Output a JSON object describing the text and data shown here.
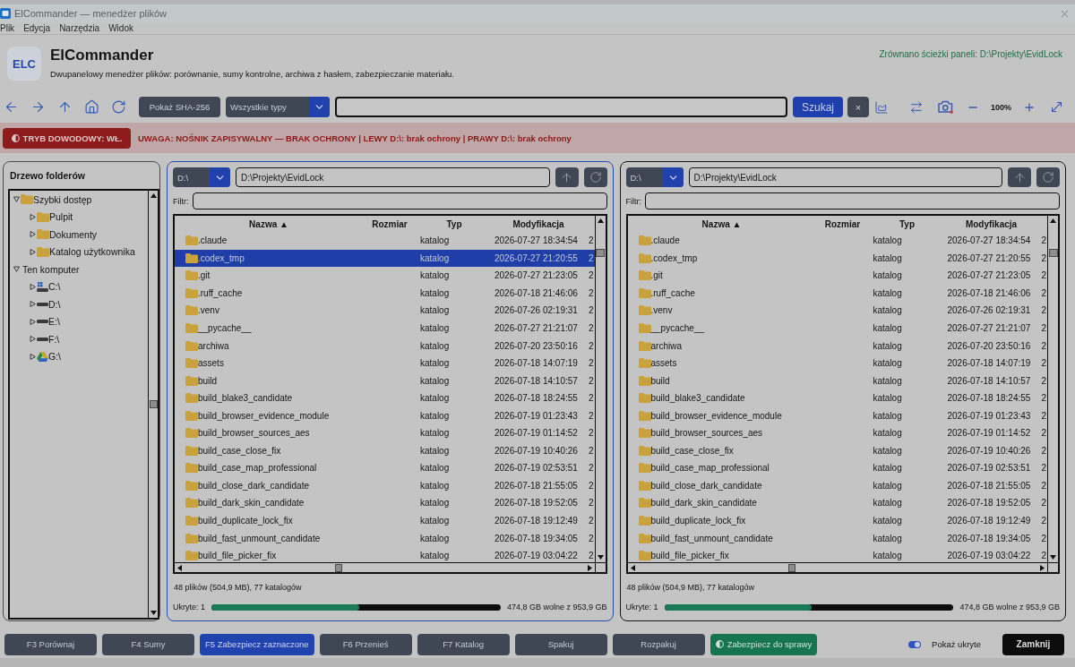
{
  "window": {
    "title": "ElCommander — menedżer plików"
  },
  "menu": [
    "Plik",
    "Edycja",
    "Narzędzia",
    "Widok"
  ],
  "header": {
    "logo": "ELC",
    "title": "ElCommander",
    "subtitle": "Dwupanelowy menedżer plików: porównanie, sumy kontrolne, archiwa z hasłem, zabezpieczanie materiału.",
    "sync_status": "Zrównano ścieżki paneli: D:\\Projekty\\EvidLock"
  },
  "toolbar": {
    "hash_button": "Pokaż SHA-256",
    "type_filter": "Wszystkie typy",
    "search_button": "Szukaj",
    "clear_button": "×",
    "zoom": "100%"
  },
  "evidence_bar": {
    "mode_button": "TRYB DOWODOWY: WŁ.",
    "warning": "UWAGA: NOŚNIK ZAPISYWALNY — BRAK OCHRONY | LEWY D:\\: brak ochrony | PRAWY D:\\: brak ochrony"
  },
  "tree": {
    "title": "Drzewo folderów",
    "items": [
      {
        "label": "Szybki dostęp",
        "kind": "folder",
        "expanded": true,
        "children": [
          {
            "label": "Pulpit",
            "kind": "folder",
            "expanded": false
          },
          {
            "label": "Dokumenty",
            "kind": "folder",
            "expanded": false
          },
          {
            "label": "Katalog użytkownika",
            "kind": "folder",
            "expanded": false
          }
        ]
      },
      {
        "label": "Ten komputer",
        "kind": "group",
        "expanded": true,
        "children": [
          {
            "label": "C:\\",
            "kind": "system-drive",
            "expanded": false
          },
          {
            "label": "D:\\",
            "kind": "drive",
            "expanded": false
          },
          {
            "label": "E:\\",
            "kind": "drive",
            "expanded": false
          },
          {
            "label": "F:\\",
            "kind": "drive",
            "expanded": false
          },
          {
            "label": "G:\\",
            "kind": "cloud-drive",
            "expanded": false
          }
        ]
      }
    ]
  },
  "panels": [
    {
      "active": true,
      "drive": "D:\\",
      "path": "D:\\Projekty\\EvidLock",
      "filter_label": "Filtr:",
      "columns": [
        "Nazwa ▲",
        "Rozmiar",
        "Typ",
        "Modyfikacja"
      ],
      "rows": [
        {
          "name": ".claude",
          "type": "katalog",
          "modified": "2026-07-27 18:34:54",
          "column_5": "2",
          "selected": false
        },
        {
          "name": ".codex_tmp",
          "type": "katalog",
          "modified": "2026-07-27 21:20:55",
          "column_5": "2",
          "selected": true
        },
        {
          "name": ".git",
          "type": "katalog",
          "modified": "2026-07-27 21:23:05",
          "column_5": "2",
          "selected": false
        },
        {
          "name": ".ruff_cache",
          "type": "katalog",
          "modified": "2026-07-18 21:46:06",
          "column_5": "2",
          "selected": false
        },
        {
          "name": ".venv",
          "type": "katalog",
          "modified": "2026-07-26 02:19:31",
          "column_5": "2",
          "selected": false
        },
        {
          "name": "__pycache__",
          "type": "katalog",
          "modified": "2026-07-27 21:21:07",
          "column_5": "2",
          "selected": false
        },
        {
          "name": "archiwa",
          "type": "katalog",
          "modified": "2026-07-20 23:50:16",
          "column_5": "2",
          "selected": false
        },
        {
          "name": "assets",
          "type": "katalog",
          "modified": "2026-07-18 14:07:19",
          "column_5": "2",
          "selected": false
        },
        {
          "name": "build",
          "type": "katalog",
          "modified": "2026-07-18 14:10:57",
          "column_5": "2",
          "selected": false
        },
        {
          "name": "build_blake3_candidate",
          "type": "katalog",
          "modified": "2026-07-18 18:24:55",
          "column_5": "2",
          "selected": false
        },
        {
          "name": "build_browser_evidence_module",
          "type": "katalog",
          "modified": "2026-07-19 01:23:43",
          "column_5": "2",
          "selected": false
        },
        {
          "name": "build_browser_sources_aes",
          "type": "katalog",
          "modified": "2026-07-19 01:14:52",
          "column_5": "2",
          "selected": false
        },
        {
          "name": "build_case_close_fix",
          "type": "katalog",
          "modified": "2026-07-19 10:40:26",
          "column_5": "2",
          "selected": false
        },
        {
          "name": "build_case_map_professional",
          "type": "katalog",
          "modified": "2026-07-19 02:53:51",
          "column_5": "2",
          "selected": false
        },
        {
          "name": "build_close_dark_candidate",
          "type": "katalog",
          "modified": "2026-07-18 21:55:05",
          "column_5": "2",
          "selected": false
        },
        {
          "name": "build_dark_skin_candidate",
          "type": "katalog",
          "modified": "2026-07-18 19:52:05",
          "column_5": "2",
          "selected": false
        },
        {
          "name": "build_duplicate_lock_fix",
          "type": "katalog",
          "modified": "2026-07-18 19:12:49",
          "column_5": "2",
          "selected": false
        },
        {
          "name": "build_fast_unmount_candidate",
          "type": "katalog",
          "modified": "2026-07-18 19:34:05",
          "column_5": "2",
          "selected": false
        },
        {
          "name": "build_file_picker_fix",
          "type": "katalog",
          "modified": "2026-07-19 03:04:22",
          "column_5": "2",
          "selected": false
        }
      ],
      "summary": "48 plików (504,9 MB), 77 katalogów",
      "hidden": "Ukryte: 1",
      "disk": {
        "level": 0.51,
        "free": "474,8 GB wolne z 953,9 GB"
      }
    },
    {
      "active": false,
      "drive": "D:\\",
      "path": "D:\\Projekty\\EvidLock",
      "filter_label": "Filtr:",
      "columns": [
        "Nazwa ▲",
        "Rozmiar",
        "Typ",
        "Modyfikacja"
      ],
      "rows": [
        {
          "name": ".claude",
          "type": "katalog",
          "modified": "2026-07-27 18:34:54",
          "column_5": "2",
          "selected": false
        },
        {
          "name": ".codex_tmp",
          "type": "katalog",
          "modified": "2026-07-27 21:20:55",
          "column_5": "2",
          "selected": false
        },
        {
          "name": ".git",
          "type": "katalog",
          "modified": "2026-07-27 21:23:05",
          "column_5": "2",
          "selected": false
        },
        {
          "name": ".ruff_cache",
          "type": "katalog",
          "modified": "2026-07-18 21:46:06",
          "column_5": "2",
          "selected": false
        },
        {
          "name": ".venv",
          "type": "katalog",
          "modified": "2026-07-26 02:19:31",
          "column_5": "2",
          "selected": false
        },
        {
          "name": "__pycache__",
          "type": "katalog",
          "modified": "2026-07-27 21:21:07",
          "column_5": "2",
          "selected": false
        },
        {
          "name": "archiwa",
          "type": "katalog",
          "modified": "2026-07-20 23:50:16",
          "column_5": "2",
          "selected": false
        },
        {
          "name": "assets",
          "type": "katalog",
          "modified": "2026-07-18 14:07:19",
          "column_5": "2",
          "selected": false
        },
        {
          "name": "build",
          "type": "katalog",
          "modified": "2026-07-18 14:10:57",
          "column_5": "2",
          "selected": false
        },
        {
          "name": "build_blake3_candidate",
          "type": "katalog",
          "modified": "2026-07-18 18:24:55",
          "column_5": "2",
          "selected": false
        },
        {
          "name": "build_browser_evidence_module",
          "type": "katalog",
          "modified": "2026-07-19 01:23:43",
          "column_5": "2",
          "selected": false
        },
        {
          "name": "build_browser_sources_aes",
          "type": "katalog",
          "modified": "2026-07-19 01:14:52",
          "column_5": "2",
          "selected": false
        },
        {
          "name": "build_case_close_fix",
          "type": "katalog",
          "modified": "2026-07-19 10:40:26",
          "column_5": "2",
          "selected": false
        },
        {
          "name": "build_case_map_professional",
          "type": "katalog",
          "modified": "2026-07-19 02:53:51",
          "column_5": "2",
          "selected": false
        },
        {
          "name": "build_close_dark_candidate",
          "type": "katalog",
          "modified": "2026-07-18 21:55:05",
          "column_5": "2",
          "selected": false
        },
        {
          "name": "build_dark_skin_candidate",
          "type": "katalog",
          "modified": "2026-07-18 19:52:05",
          "column_5": "2",
          "selected": false
        },
        {
          "name": "build_duplicate_lock_fix",
          "type": "katalog",
          "modified": "2026-07-18 19:12:49",
          "column_5": "2",
          "selected": false
        },
        {
          "name": "build_fast_unmount_candidate",
          "type": "katalog",
          "modified": "2026-07-18 19:34:05",
          "column_5": "2",
          "selected": false
        },
        {
          "name": "build_file_picker_fix",
          "type": "katalog",
          "modified": "2026-07-19 03:04:22",
          "column_5": "2",
          "selected": false
        }
      ],
      "summary": "48 plików (504,9 MB), 77 katalogów",
      "hidden": "Ukryte: 1",
      "disk": {
        "level": 0.51,
        "free": "474,8 GB wolne z 953,9 GB"
      }
    }
  ],
  "actions": [
    {
      "label": "F3 Porównaj",
      "kind": "default"
    },
    {
      "label": "F4 Sumy",
      "kind": "default"
    },
    {
      "label": "F5 Zabezpiecz zaznaczone",
      "kind": "primary"
    },
    {
      "label": "F6 Przenieś",
      "kind": "default"
    },
    {
      "label": "F7 Katalog",
      "kind": "default"
    },
    {
      "label": "Spakuj",
      "kind": "default"
    },
    {
      "label": "Rozpakuj",
      "kind": "default"
    },
    {
      "label": "Zabezpiecz do sprawy",
      "kind": "secure"
    }
  ],
  "show_hidden": {
    "label": "Pokaż ukryte",
    "on": true
  },
  "close_button": "Zamknij"
}
